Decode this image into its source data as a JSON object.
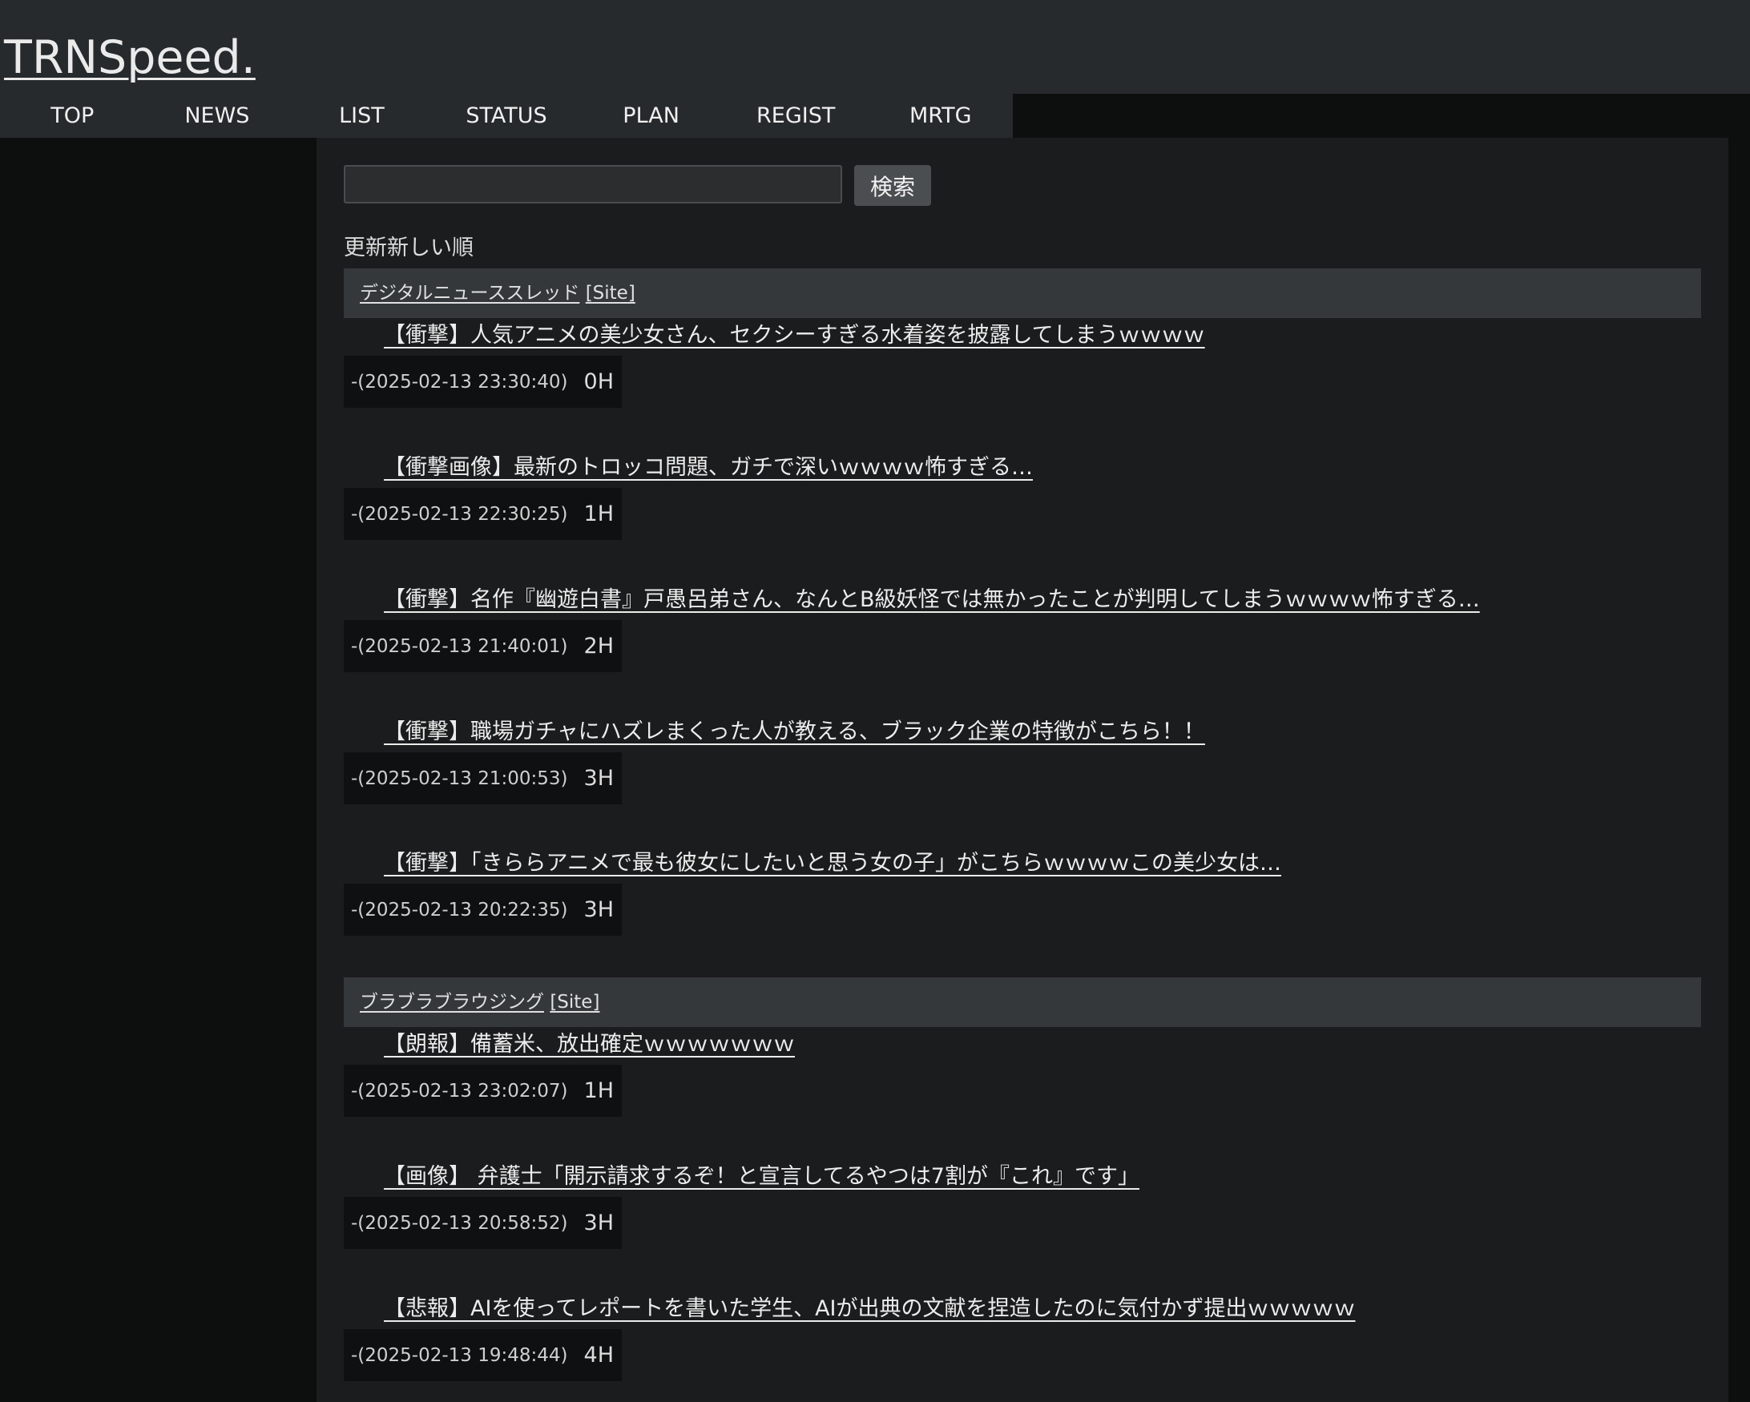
{
  "header": {
    "logo": "TRNSpeed."
  },
  "nav": {
    "items": [
      "TOP",
      "NEWS",
      "LIST",
      "STATUS",
      "PLAN",
      "REGIST",
      "MRTG"
    ]
  },
  "search": {
    "value": "",
    "button_label": "検索"
  },
  "sort_label": "更新新しい順",
  "sites": [
    {
      "name": "デジタルニューススレッド",
      "site_link": "[Site]",
      "articles": [
        {
          "title": "【衝撃】人気アニメの美少女さん、セクシーすぎる水着姿を披露してしまうｗｗｗｗ",
          "date": "-(2025-02-13 23:30:40)",
          "hours": "0H"
        },
        {
          "title": "【衝撃画像】最新のトロッコ問題、ガチで深いｗｗｗｗ怖すぎる…",
          "date": "-(2025-02-13 22:30:25)",
          "hours": "1H"
        },
        {
          "title": "【衝撃】名作『幽遊白書』戸愚呂弟さん、なんとB級妖怪では無かったことが判明してしまうｗｗｗｗ怖すぎる…",
          "date": "-(2025-02-13 21:40:01)",
          "hours": "2H"
        },
        {
          "title": "【衝撃】職場ガチャにハズレまくった人が教える、ブラック企業の特徴がこちら！！",
          "date": "-(2025-02-13 21:00:53)",
          "hours": "3H"
        },
        {
          "title": "【衝撃】「きららアニメで最も彼女にしたいと思う女の子」がこちらｗｗｗｗこの美少女は…",
          "date": "-(2025-02-13 20:22:35)",
          "hours": "3H"
        }
      ]
    },
    {
      "name": "ブラブラブラウジング",
      "site_link": "[Site]",
      "articles": [
        {
          "title": "【朗報】備蓄米、放出確定ｗｗｗｗｗｗｗ",
          "date": "-(2025-02-13 23:02:07)",
          "hours": "1H"
        },
        {
          "title": "【画像】 弁護士「開示請求するぞ！と宣言してるやつは7割が『これ』です」",
          "date": "-(2025-02-13 20:58:52)",
          "hours": "3H"
        },
        {
          "title": "【悲報】AIを使ってレポートを書いた学生、AIが出典の文献を捏造したのに気付かず提出ｗｗｗｗｗ",
          "date": "-(2025-02-13 19:48:44)",
          "hours": "4H"
        }
      ]
    }
  ]
}
